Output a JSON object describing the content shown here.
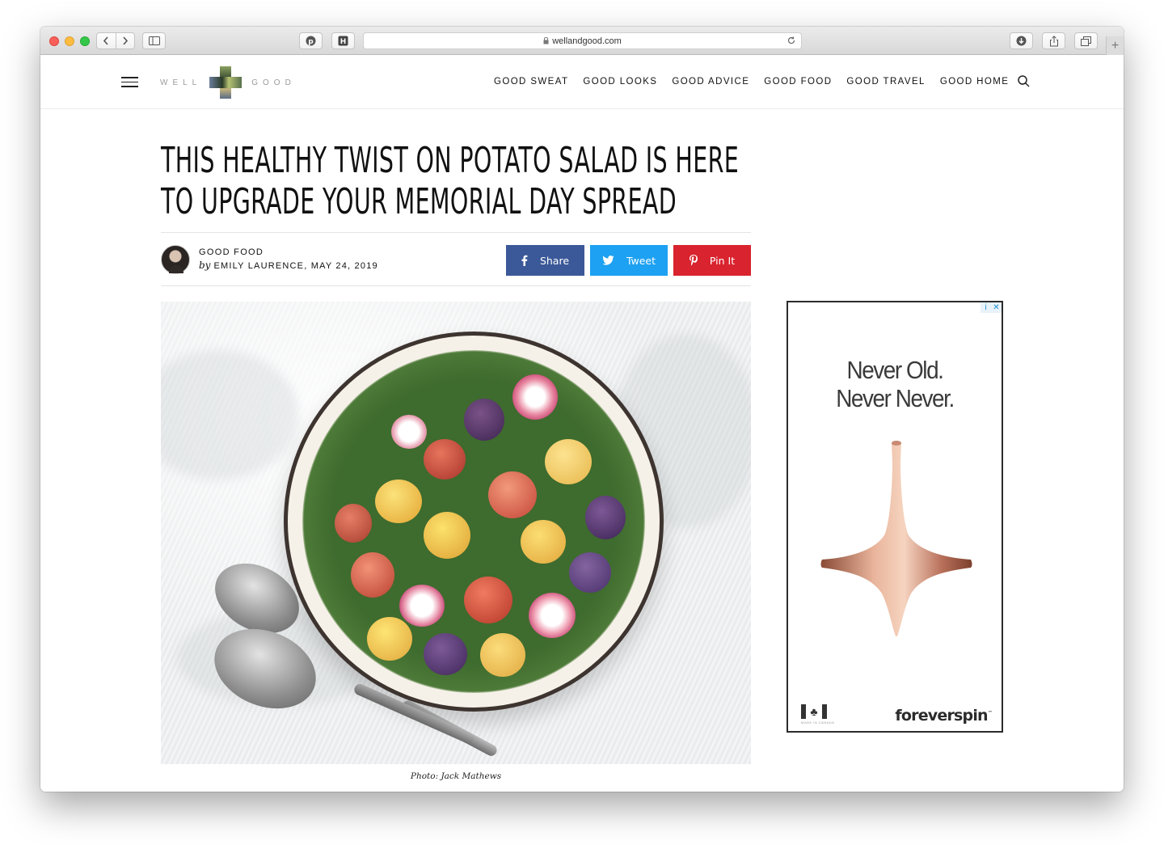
{
  "browser": {
    "url": "wellandgood.com",
    "new_tab_label": "+"
  },
  "site": {
    "logo_left": "WELL",
    "logo_right": "GOOD",
    "nav": [
      {
        "label": "GOOD SWEAT"
      },
      {
        "label": "GOOD LOOKS"
      },
      {
        "label": "GOOD ADVICE"
      },
      {
        "label": "GOOD FOOD"
      },
      {
        "label": "GOOD TRAVEL"
      },
      {
        "label": "GOOD HOME"
      }
    ]
  },
  "article": {
    "headline_line1": "THIS HEALTHY TWIST ON POTATO SALAD IS HERE",
    "headline_line2": "TO UPGRADE YOUR MEMORIAL DAY SPREAD",
    "category": "GOOD FOOD",
    "by_prefix": "by",
    "author_date": "EMILY LAURENCE, MAY 24, 2019",
    "share": {
      "facebook": "Share",
      "twitter": "Tweet",
      "pinterest": "Pin It"
    },
    "caption": "Photo: Jack Mathews"
  },
  "ad": {
    "adchoices_info": "i",
    "adchoices_close": "✕",
    "tagline_line1": "Never Old.",
    "tagline_line2": "Never Never.",
    "brand": "foreverspin",
    "trademark": "™",
    "made_in": "MADE IN CANADA"
  },
  "colors": {
    "facebook": "#3b5998",
    "twitter": "#1da1f2",
    "pinterest": "#d9232e"
  }
}
